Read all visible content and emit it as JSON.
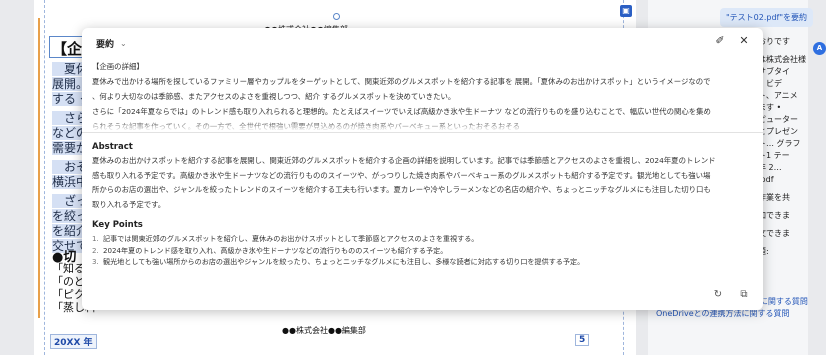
{
  "document": {
    "header_text": "●●株式会社●●編集部",
    "heading": "【企画",
    "body_lines": [
      {
        "text": "　夏休",
        "gap": false
      },
      {
        "text": "展開。",
        "gap": false
      },
      {
        "text": "する グル",
        "gap": false
      },
      {
        "text": "　さらに",
        "gap": true
      },
      {
        "text": "などの流",
        "gap": false
      },
      {
        "text": "需要が",
        "gap": false
      },
      {
        "text": "　おそ",
        "gap": true
      },
      {
        "text": "横浜中",
        "gap": false
      },
      {
        "text": "　ざっく",
        "gap": true
      },
      {
        "text": "を絞っ",
        "gap": false
      },
      {
        "text": "を紹介",
        "gap": false
      },
      {
        "text": "交せて",
        "gap": false
      }
    ],
    "subheading": "●切",
    "list_lines": [
      "「知る人",
      "「のどこ",
      "「ピクニ",
      "「蒸し料"
    ],
    "footer_text": "●●株式会社●●編集部",
    "year_label": "20XX 年",
    "page_number": "5"
  },
  "right_panel": {
    "summary_chip": "\"テスト02.pdf\"を要約",
    "text_lines": [
      {
        "text": "おりです",
        "gap": false
      },
      {
        "text": "は株式会社様",
        "gap": true
      },
      {
        "text": "サブタイ",
        "gap": false
      },
      {
        "text": "、ビデ",
        "gap": false
      },
      {
        "text": "ト、アニメ",
        "gap": false
      },
      {
        "text": "ます •",
        "gap": false
      },
      {
        "text": "ピューター",
        "gap": false
      },
      {
        "text": "とプレゼン",
        "gap": false
      },
      {
        "text": "ト… グラフ",
        "gap": false
      },
      {
        "text": "ト1 テー",
        "gap": false
      },
      {
        "text": "年 2…",
        "gap": false
      },
      {
        "text": ".pdf",
        "gap": false
      },
      {
        "text": "作業を共",
        "gap": true
      },
      {
        "text": "加できま",
        "gap": true
      },
      {
        "text": "文できま",
        "gap": true
      },
      {
        "text": "題:",
        "gap": true
      }
    ],
    "links": [
      "的な質問",
      "プレゼンテーション作成方法に関する質問",
      "OneDriveとの連携方法に関する質問"
    ]
  },
  "popup": {
    "title": "要約",
    "upper_lines": [
      "【企画の詳細】",
      "夏休みで出かける場所を探しているファミリー層やカップルをターゲットとして、関東近郊のグルメスポットを紹介する記事を 展開。「夏休みのお出かけスポット」というイメージなので",
      "、何より大切なのは季節感、またアクセスのよさを重視しつつ、紹介 するグルメスポットを決めていきたい。",
      "さらに「2024年夏ならでは」のトレンド感も取り入れられると理想的。たとえばスイーツでいえば高級かき氷や生ドーナツ などの流行りものを盛り込むことで、幅広い世代の関心を集め",
      "られそうな記事を作っていく。その一方で、全世代で根強い需要が見込めるのが焼き肉系やバーベキュー系といったおそるおそる"
    ],
    "abstract": {
      "title": "Abstract",
      "lines": [
        "夏休みのお出かけスポットを紹介する記事を展開し、関東近郊のグルメスポットを紹介する企画の詳細を説明しています。記事では季節感とアクセスのよさを重視し、2024年夏のトレンド",
        "感も取り入れる予定です。高級かき氷や生ドーナツなどの流行りもののスイーツや、がっつりした焼き肉系やバーベキュー系のグルメスポットも紹介する予定です。観光地としても強い場",
        "所からのお店の選出や、ジャンルを絞ったトレンドのスイーツを紹介する工夫も行います。夏カレーや冷やしラーメンなどの名店の紹介や、ちょっとニッチなグルメにも注目した切り口も",
        "取り入れる予定です。"
      ]
    },
    "key_points": {
      "title": "Key Points",
      "items": [
        "記事では関東近郊のグルメスポットを紹介し、夏休みのお出かけスポットとして季節感とアクセスのよさを重視する。",
        "2024年夏のトレンド感を取り入れ、高級かき氷や生ドーナツなどの流行りもののスイーツも紹介する予定。",
        "観光地としても強い場所からのお店の選出やジャンルを絞ったり、ちょっとニッチなグルメにも注目し、多様な読者に対応する切り口を提供する予定。"
      ]
    },
    "icons": {
      "pin": "pin-icon",
      "close": "close-icon",
      "refresh": "refresh-icon",
      "copy": "copy-icon"
    }
  },
  "colors": {
    "accent": "#2456b8",
    "selection": "#d5e0f4",
    "orange_rule": "#e8a04a"
  }
}
